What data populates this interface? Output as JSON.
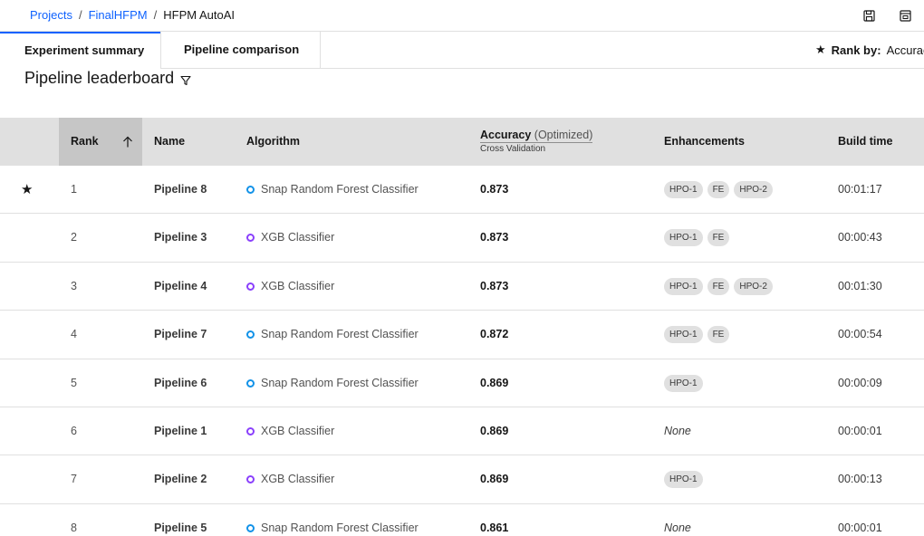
{
  "breadcrumb": {
    "items": [
      "Projects",
      "FinalHFPM"
    ],
    "separator": "/",
    "current": "HFPM AutoAI"
  },
  "toolbar": {
    "icons": [
      "save-icon",
      "notebook-icon"
    ]
  },
  "tabs": [
    {
      "label": "Experiment summary",
      "active": true
    },
    {
      "label": "Pipeline comparison",
      "active": false
    }
  ],
  "rank_by": {
    "label": "Rank by:",
    "value": "Accuracy"
  },
  "leaderboard": {
    "title": "Pipeline leaderboard",
    "columns": {
      "rank": "Rank",
      "name": "Name",
      "algorithm": "Algorithm",
      "accuracy": "Accuracy",
      "accuracy_note": "(Optimized)",
      "accuracy_sub": "Cross Validation",
      "enhancements": "Enhancements",
      "build_time": "Build time"
    },
    "rows": [
      {
        "starred": true,
        "rank": "1",
        "name": "Pipeline 8",
        "algorithm": "Snap Random Forest Classifier",
        "algo_color": "#1192e8",
        "accuracy": "0.873",
        "enhancements": [
          "HPO-1",
          "FE",
          "HPO-2"
        ],
        "build_time": "00:01:17"
      },
      {
        "starred": false,
        "rank": "2",
        "name": "Pipeline 3",
        "algorithm": "XGB Classifier",
        "algo_color": "#8a3ffc",
        "accuracy": "0.873",
        "enhancements": [
          "HPO-1",
          "FE"
        ],
        "build_time": "00:00:43"
      },
      {
        "starred": false,
        "rank": "3",
        "name": "Pipeline 4",
        "algorithm": "XGB Classifier",
        "algo_color": "#8a3ffc",
        "accuracy": "0.873",
        "enhancements": [
          "HPO-1",
          "FE",
          "HPO-2"
        ],
        "build_time": "00:01:30"
      },
      {
        "starred": false,
        "rank": "4",
        "name": "Pipeline 7",
        "algorithm": "Snap Random Forest Classifier",
        "algo_color": "#1192e8",
        "accuracy": "0.872",
        "enhancements": [
          "HPO-1",
          "FE"
        ],
        "build_time": "00:00:54"
      },
      {
        "starred": false,
        "rank": "5",
        "name": "Pipeline 6",
        "algorithm": "Snap Random Forest Classifier",
        "algo_color": "#1192e8",
        "accuracy": "0.869",
        "enhancements": [
          "HPO-1"
        ],
        "build_time": "00:00:09"
      },
      {
        "starred": false,
        "rank": "6",
        "name": "Pipeline 1",
        "algorithm": "XGB Classifier",
        "algo_color": "#8a3ffc",
        "accuracy": "0.869",
        "enhancements": [],
        "enhancements_empty": "None",
        "build_time": "00:00:01"
      },
      {
        "starred": false,
        "rank": "7",
        "name": "Pipeline 2",
        "algorithm": "XGB Classifier",
        "algo_color": "#8a3ffc",
        "accuracy": "0.869",
        "enhancements": [
          "HPO-1"
        ],
        "build_time": "00:00:13"
      },
      {
        "starred": false,
        "rank": "8",
        "name": "Pipeline 5",
        "algorithm": "Snap Random Forest Classifier",
        "algo_color": "#1192e8",
        "accuracy": "0.861",
        "enhancements": [],
        "enhancements_empty": "None",
        "build_time": "00:00:01"
      }
    ]
  }
}
